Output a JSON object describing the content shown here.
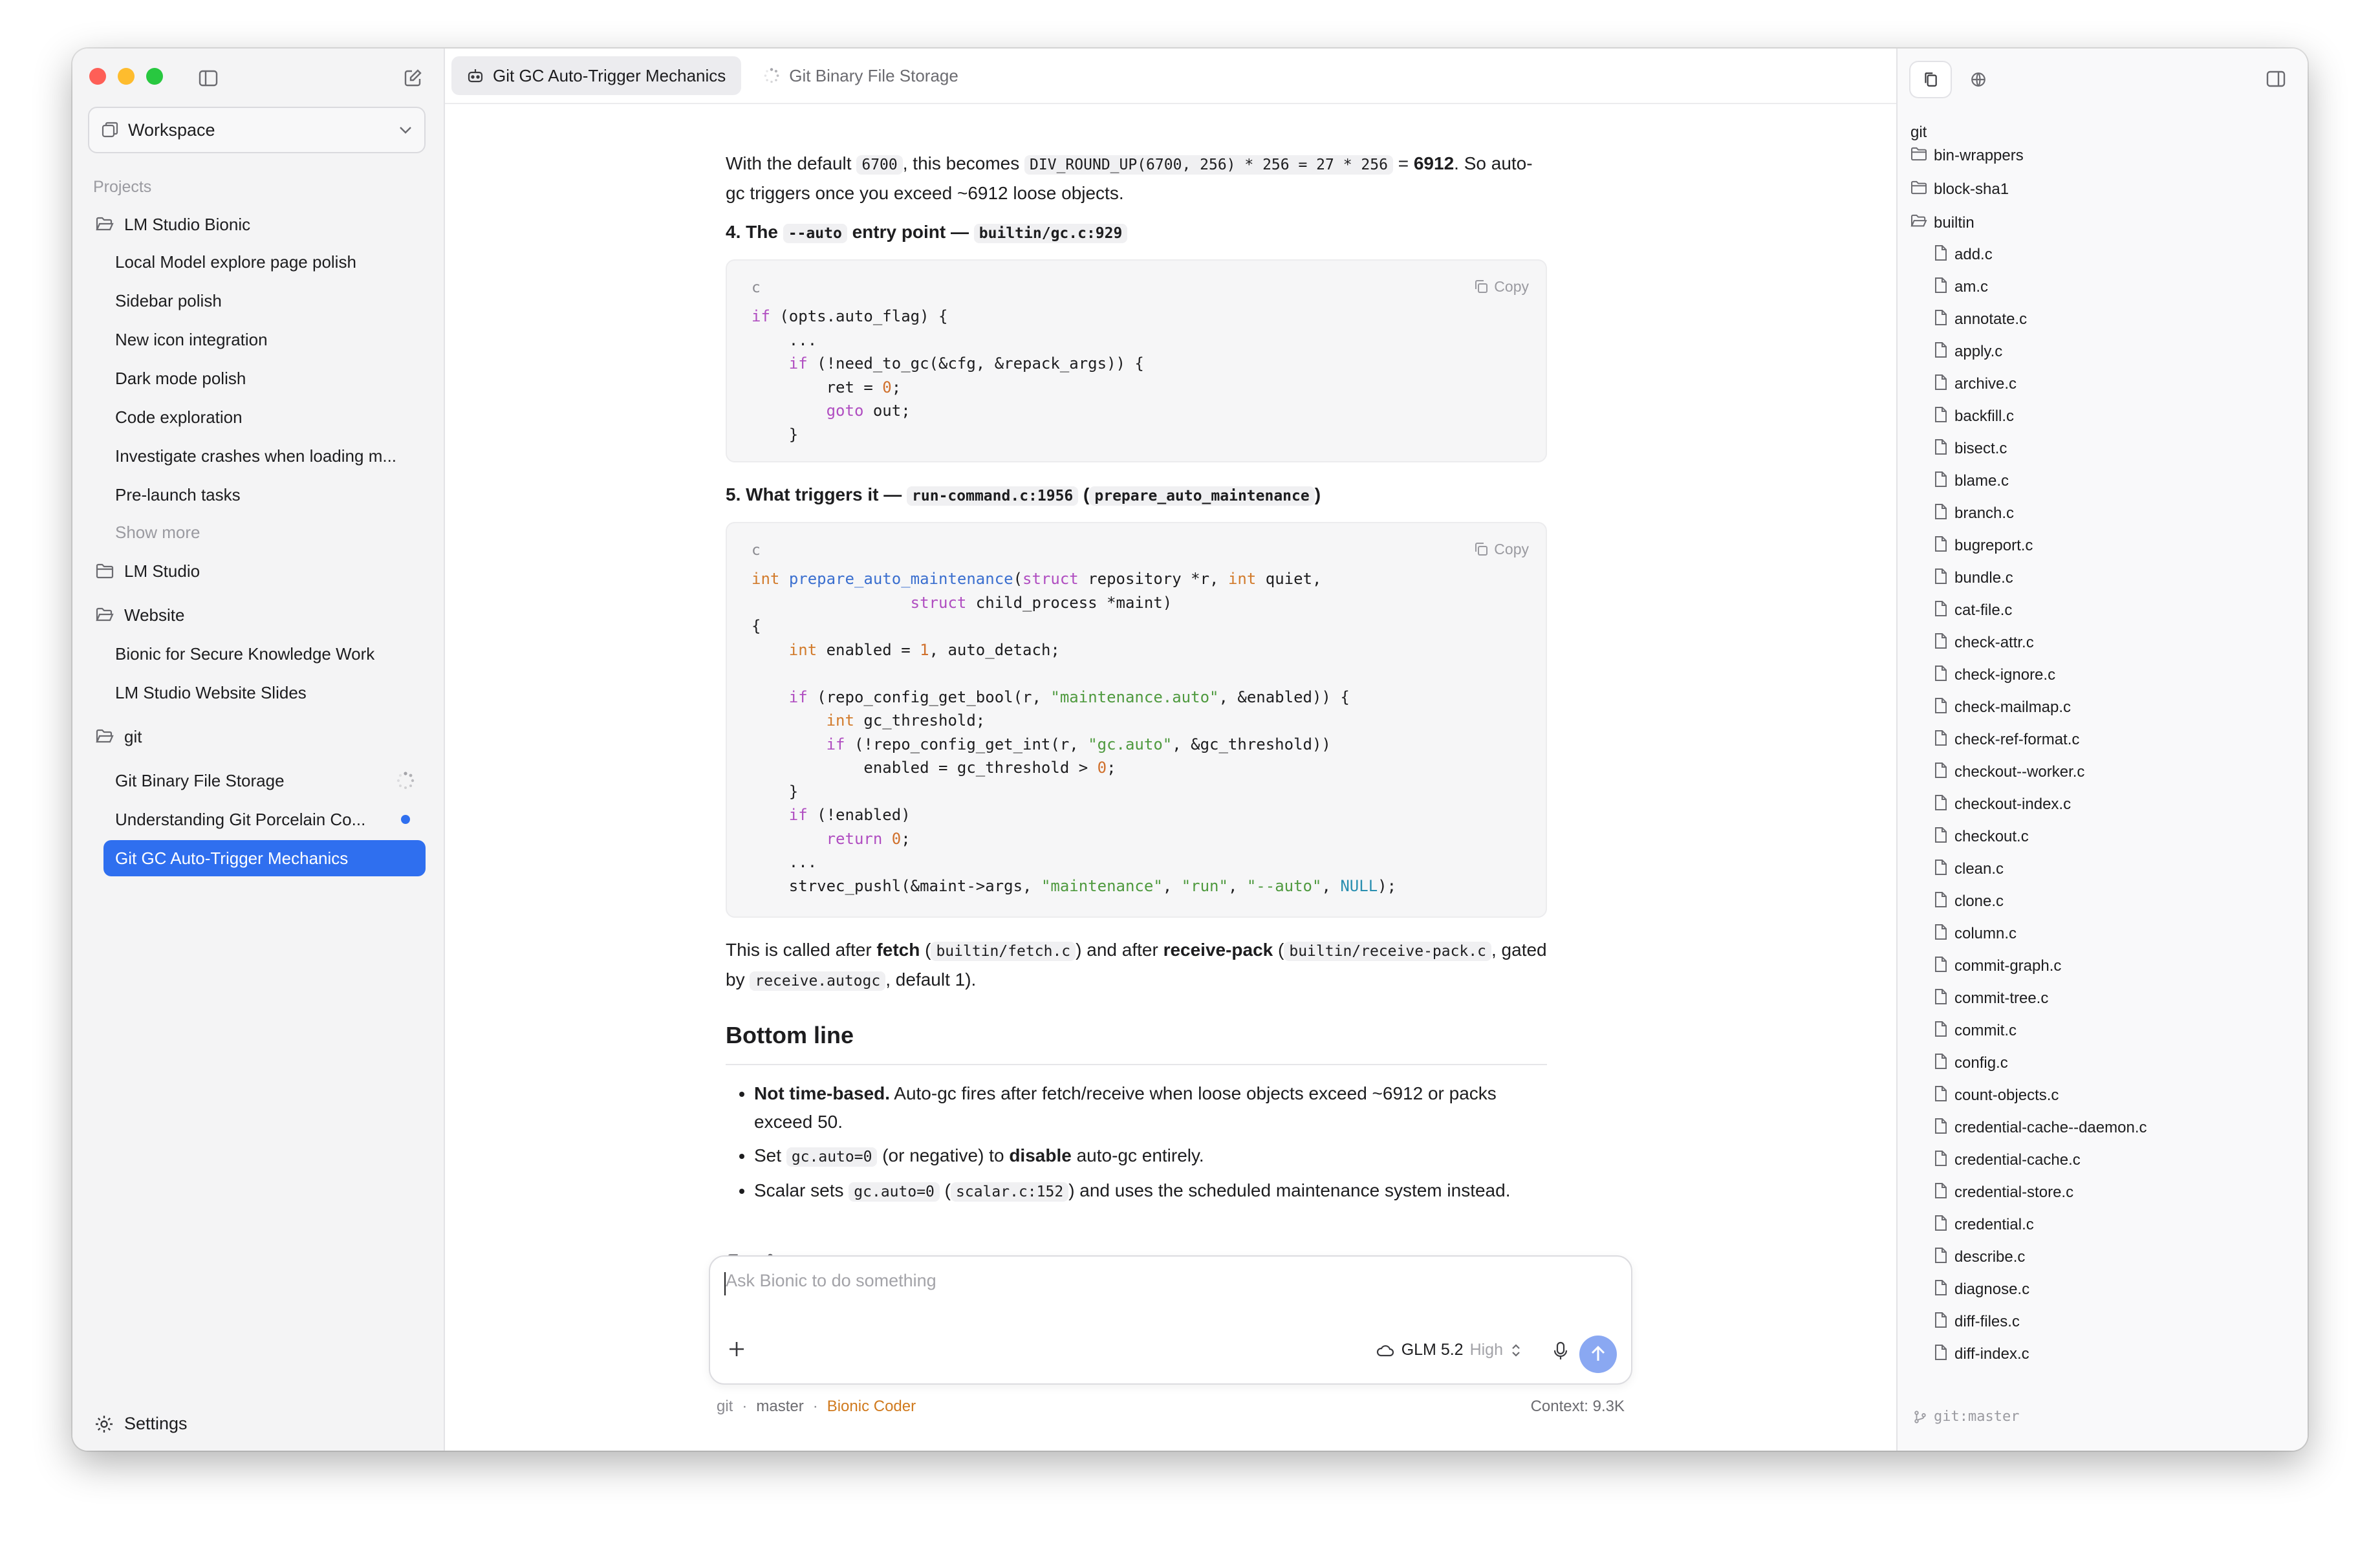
{
  "sidebar": {
    "workspace_label": "Workspace",
    "projects_heading": "Projects",
    "project_1": "LM Studio Bionic",
    "project_1_chats": [
      "Local Model explore page polish",
      "Sidebar polish",
      "New icon integration",
      "Dark mode polish",
      "Code exploration",
      "Investigate crashes when loading m...",
      "Pre-launch tasks"
    ],
    "show_more": "Show more",
    "project_2": "LM Studio",
    "project_3": "Website",
    "project_3_chats": [
      "Bionic for Secure Knowledge Work",
      "LM Studio Website Slides"
    ],
    "project_4": "git",
    "project_4_chats": [
      "Git Binary File Storage",
      "Understanding Git Porcelain Co...",
      "Git GC Auto-Trigger Mechanics"
    ],
    "settings_label": "Settings"
  },
  "tabs": {
    "active": "Git GC Auto-Trigger Mechanics",
    "second": "Git Binary File Storage"
  },
  "content": {
    "p1_a": "With the default ",
    "p1_code1": "6700",
    "p1_b": ", this becomes ",
    "p1_code2": "DIV_ROUND_UP(6700, 256) * 256 = 27 * 256",
    "p1_c": " = ",
    "p1_bold": "6912",
    "p1_d": ". So auto-gc triggers once you exceed ~6912 loose objects.",
    "h4_a": "4. The ",
    "h4_code1": "--auto",
    "h4_b": " entry point — ",
    "h4_code2": "builtin/gc.c:929",
    "code1_lang": "c",
    "copy_label": "Copy",
    "h5_a": "5. What triggers it — ",
    "h5_code1": "run-command.c:1956",
    "h5_b": " (",
    "h5_code2": "prepare_auto_maintenance",
    "h5_c": ")",
    "code2_lang": "c",
    "p2_a": "This is called after ",
    "p2_b1": "fetch",
    "p2_c": " (",
    "p2_code1": "builtin/fetch.c",
    "p2_d": ") and after ",
    "p2_b2": "receive-pack",
    "p2_e": " (",
    "p2_code2": "builtin/receive-pack.c",
    "p2_f": ", gated by ",
    "p2_code3": "receive.autogc",
    "p2_g": ", default 1).",
    "heading": "Bottom line",
    "b1_bold": "Not time-based.",
    "b1_rest": " Auto-gc fires after fetch/receive when loose objects exceed ~6912 or packs exceed 50.",
    "b2_a": "Set ",
    "b2_code": "gc.auto=0",
    "b2_b": " (or negative) to ",
    "b2_bold": "disable",
    "b2_c": " auto-gc entirely.",
    "b3_a": "Scalar sets ",
    "b3_code1": "gc.auto=0",
    "b3_b": " (",
    "b3_code2": "scalar.c:152",
    "b3_c": ") and uses the scheduled maintenance system instead."
  },
  "composer": {
    "placeholder": "Ask Bionic to do something",
    "model": "GLM 5.2",
    "effort": "High"
  },
  "status": {
    "repo": "git",
    "branch": "master",
    "agent": "Bionic Coder",
    "context": "Context: 9.3K"
  },
  "files": {
    "root": "git",
    "folders": [
      "bin-wrappers",
      "block-sha1",
      "builtin"
    ],
    "files": [
      "add.c",
      "am.c",
      "annotate.c",
      "apply.c",
      "archive.c",
      "backfill.c",
      "bisect.c",
      "blame.c",
      "branch.c",
      "bugreport.c",
      "bundle.c",
      "cat-file.c",
      "check-attr.c",
      "check-ignore.c",
      "check-mailmap.c",
      "check-ref-format.c",
      "checkout--worker.c",
      "checkout-index.c",
      "checkout.c",
      "clean.c",
      "clone.c",
      "column.c",
      "commit-graph.c",
      "commit-tree.c",
      "commit.c",
      "config.c",
      "count-objects.c",
      "credential-cache--daemon.c",
      "credential-cache.c",
      "credential-store.c",
      "credential.c",
      "describe.c",
      "diagnose.c",
      "diff-files.c",
      "diff-index.c"
    ],
    "branch_footer": "git:master"
  },
  "colors": {
    "accent": "#2f6fef",
    "send": "#8aa8f2",
    "agent": "#d07a1e"
  }
}
